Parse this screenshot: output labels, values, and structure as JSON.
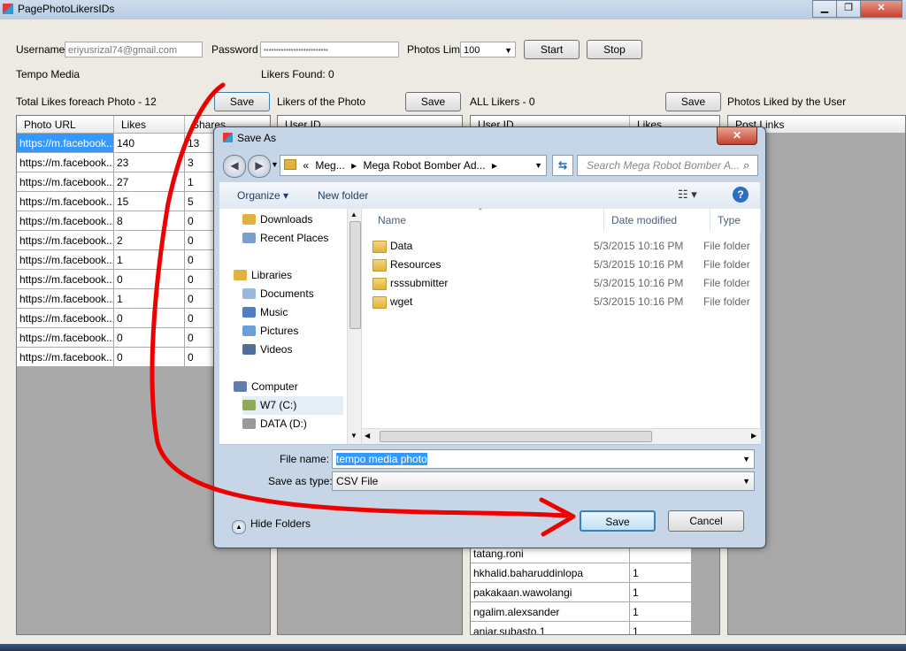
{
  "window": {
    "title": "PagePhotoLikersIDs",
    "min": "▁",
    "max": "❐",
    "close": "✕"
  },
  "form": {
    "username_label": "Username",
    "username_value": "eriyusrizal74@gmail.com",
    "password_label": "Password",
    "password_value": "••••••••••••••••••••••••••",
    "photos_limit_label": "Photos Limit",
    "photos_limit_value": "100",
    "start_label": "Start",
    "stop_label": "Stop",
    "tempo_media_label": "Tempo Media",
    "likers_found_label": "Likers Found: 0",
    "total_likes_label": "Total Likes foreach Photo  - 12",
    "save1_label": "Save",
    "likers_of_photo_label": "Likers of the Photo",
    "save2_label": "Save",
    "all_likers_label": "ALL Likers - 0",
    "save3_label": "Save",
    "photos_liked_label": "Photos Liked by the User"
  },
  "photos_grid": {
    "headers": [
      "Photo URL",
      "Likes",
      "Shares"
    ],
    "rows": [
      [
        "https://m.facebook...",
        "140",
        "13"
      ],
      [
        "https://m.facebook...",
        "23",
        "3"
      ],
      [
        "https://m.facebook...",
        "27",
        "1"
      ],
      [
        "https://m.facebook...",
        "15",
        "5"
      ],
      [
        "https://m.facebook...",
        "8",
        "0"
      ],
      [
        "https://m.facebook...",
        "2",
        "0"
      ],
      [
        "https://m.facebook...",
        "1",
        "0"
      ],
      [
        "https://m.facebook...",
        "0",
        "0"
      ],
      [
        "https://m.facebook...",
        "1",
        "0"
      ],
      [
        "https://m.facebook...",
        "0",
        "0"
      ],
      [
        "https://m.facebook...",
        "0",
        "0"
      ],
      [
        "https://m.facebook...",
        "0",
        "0"
      ]
    ]
  },
  "likers_grid": {
    "headers": [
      "User ID"
    ]
  },
  "all_likers_grid": {
    "headers": [
      "User ID",
      "Likes"
    ],
    "rows": [
      [
        "tatang.roni",
        ""
      ],
      [
        "hkhalid.baharuddinlopa",
        "1"
      ],
      [
        "pakakaan.wawolangi",
        "1"
      ],
      [
        "ngalim.alexsander",
        "1"
      ],
      [
        "anjar.subasto.1",
        "1"
      ]
    ]
  },
  "liked_grid": {
    "headers": [
      "Post Links"
    ]
  },
  "dialog": {
    "title": "Save As",
    "close": "✕",
    "path": [
      "«",
      "Meg...",
      "▸",
      "Mega Robot Bomber Ad...",
      "▸"
    ],
    "search_placeholder": "Search Mega Robot Bomber A...",
    "organize_label": "Organize ▾",
    "new_folder_label": "New folder",
    "help": "?",
    "nav": [
      {
        "label": "Downloads",
        "icon": "downloads-icon"
      },
      {
        "label": "Recent Places",
        "icon": "recent-places-icon"
      },
      {
        "label": "Libraries",
        "icon": "libraries-icon"
      },
      {
        "label": "Documents",
        "icon": "documents-icon"
      },
      {
        "label": "Music",
        "icon": "music-icon"
      },
      {
        "label": "Pictures",
        "icon": "pictures-icon"
      },
      {
        "label": "Videos",
        "icon": "videos-icon"
      },
      {
        "label": "Computer",
        "icon": "computer-icon"
      },
      {
        "label": "W7 (C:)",
        "icon": "drive-c-icon"
      },
      {
        "label": "DATA (D:)",
        "icon": "drive-d-icon"
      }
    ],
    "columns": [
      "Name",
      "Date modified",
      "Type"
    ],
    "files": [
      {
        "name": "Data",
        "date": "5/3/2015 10:16 PM",
        "type": "File folder"
      },
      {
        "name": "Resources",
        "date": "5/3/2015 10:16 PM",
        "type": "File folder"
      },
      {
        "name": "rsssubmitter",
        "date": "5/3/2015 10:16 PM",
        "type": "File folder"
      },
      {
        "name": "wget",
        "date": "5/3/2015 10:16 PM",
        "type": "File folder"
      }
    ],
    "file_name_label": "File name:",
    "file_name_value": "tempo media photo",
    "save_type_label": "Save as type:",
    "save_type_value": "CSV File",
    "hide_folders_label": "Hide Folders",
    "save_label": "Save",
    "cancel_label": "Cancel"
  },
  "colors": {
    "selection": "#3399ff",
    "annotation_arrow": "#ee0000",
    "dialog_frame": "#c7d6e6"
  }
}
